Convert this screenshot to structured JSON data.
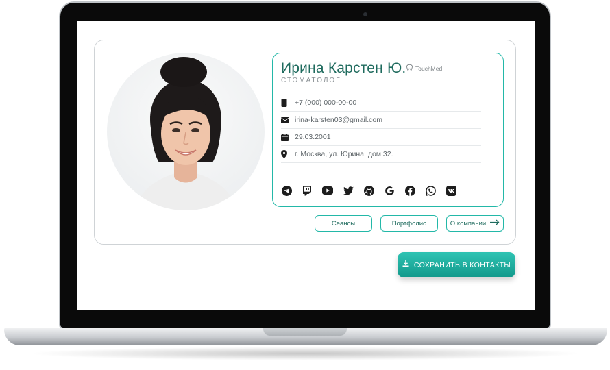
{
  "profile": {
    "name": "Ирина Карстен Ю.",
    "role": "СТОМАТОЛОГ",
    "brand": "TouchMed"
  },
  "contacts": [
    {
      "icon": "phone-icon",
      "text": "+7 (000) 000-00-00"
    },
    {
      "icon": "mail-icon",
      "text": "irina-karsten03@gmail.com"
    },
    {
      "icon": "calendar-icon",
      "text": "29.03.2001"
    },
    {
      "icon": "location-pin-icon",
      "text": "г. Москва, ул. Юрина, дом 32."
    }
  ],
  "socials": [
    "telegram-icon",
    "twitch-icon",
    "youtube-icon",
    "twitter-icon",
    "github-icon",
    "google-icon",
    "facebook-icon",
    "whatsapp-icon",
    "vk-icon"
  ],
  "buttons": {
    "sessions": "Сеансы",
    "portfolio": "Портфолио",
    "about": "О компании"
  },
  "save_button": "СОХРАНИТЬ В КОНТАКТЫ",
  "colors": {
    "accent": "#23b8a8",
    "name_text": "#1f6b5e",
    "save_gradient_top": "#2fc3b3",
    "save_gradient_bottom": "#12998b"
  }
}
